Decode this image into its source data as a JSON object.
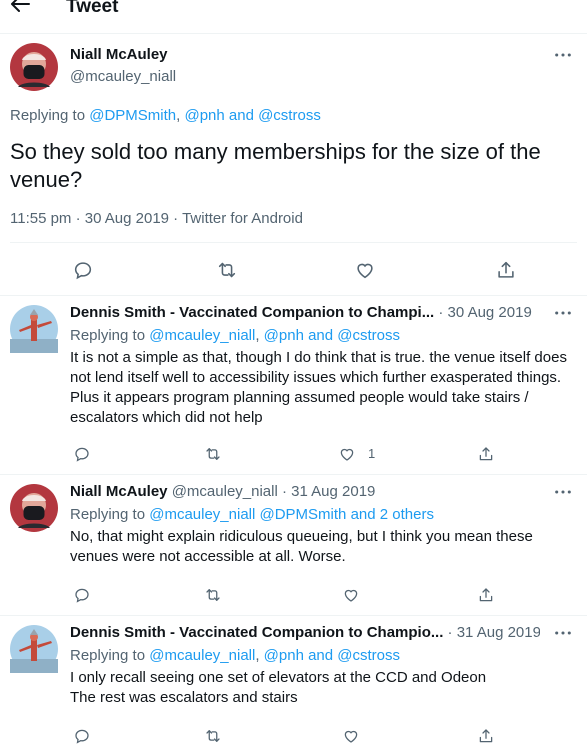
{
  "header": {
    "title": "Tweet"
  },
  "main_tweet": {
    "name": "Niall McAuley",
    "handle": "@mcauley_niall",
    "replying_prefix": "Replying to ",
    "replying_link1": "@DPMSmith",
    "replying_sep": ", ",
    "replying_link2": "@pnh and @cstross",
    "text": "So they sold too many memberships for the size of the venue?",
    "meta": "11:55 pm · 30 Aug 2019 · Twitter for Android"
  },
  "replies": [
    {
      "name": "Dennis Smith - Vaccinated Companion to Champi...",
      "handle_date": " · 30 Aug 2019",
      "replying_prefix": "Replying to ",
      "replying_link1": "@mcauley_niall",
      "replying_sep": ", ",
      "replying_link2": "@pnh and @cstross",
      "text": "It is not a simple as that, though I do think that is true.  the venue itself does not lend itself well to accessibility issues which further exasperated things.  Plus it appears program planning assumed people would take stairs / escalators which did not help",
      "like_count": "1"
    },
    {
      "name": "Niall McAuley",
      "handle_date": " @mcauley_niall · 31 Aug 2019",
      "replying_prefix": "Replying to ",
      "replying_link1": "@mcauley_niall @DPMSmith",
      "replying_sep": "  ",
      "replying_link2": "and 2 others",
      "text": "No, that might explain  ridiculous queueing, but I think you mean these venues were not accessible at all. Worse.",
      "like_count": ""
    },
    {
      "name": "Dennis Smith - Vaccinated Companion to Champio...",
      "handle_date": " · 31 Aug 2019",
      "replying_prefix": "Replying to ",
      "replying_link1": "@mcauley_niall",
      "replying_sep": ", ",
      "replying_link2": "@pnh and @cstross",
      "text": "I only recall seeing one set of elevators at the CCD and Odeon\nThe rest was escalators and stairs",
      "like_count": ""
    }
  ],
  "icons": {
    "back": "arrow-left-icon",
    "more": "more-horizontal-icon",
    "reply": "reply-bubble-icon",
    "retweet": "retweet-icon",
    "like": "heart-icon",
    "share": "share-icon"
  },
  "colors": {
    "link": "#1d9bf0",
    "muted": "#536471",
    "text": "#0f1419"
  }
}
